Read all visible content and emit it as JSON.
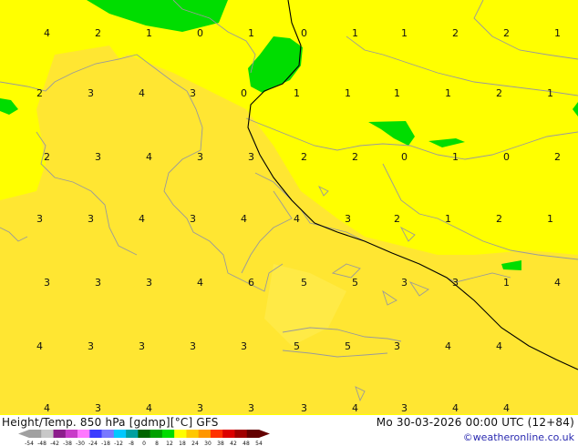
{
  "map": {
    "grid_values": [
      [
        "4",
        "2",
        "1",
        "0",
        "1",
        "0",
        "1",
        "1",
        "2",
        "2",
        "1"
      ],
      [
        "2",
        "3",
        "4",
        "3",
        "0",
        "1",
        "1",
        "1",
        "1",
        "2",
        "1"
      ],
      [
        "2",
        "3",
        "4",
        "3",
        "3",
        "2",
        "2",
        "0",
        "1",
        "0",
        "2"
      ],
      [
        "3",
        "3",
        "4",
        "3",
        "4",
        "4",
        "3",
        "2",
        "1",
        "2",
        "1"
      ],
      [
        "3",
        "3",
        "3",
        "4",
        "6",
        "5",
        "5",
        "3",
        "3",
        "1",
        "4"
      ],
      [
        "4",
        "3",
        "3",
        "3",
        "3",
        "5",
        "5",
        "3",
        "4",
        "4"
      ],
      [
        "4",
        "3",
        "4",
        "3",
        "3",
        "3",
        "4",
        "3",
        "4",
        "4"
      ]
    ],
    "colors": {
      "field_yellow": "#ffff00",
      "field_gold": "#ffe632",
      "green": "#00dd00",
      "coastline": "#9a9a9a",
      "contour": "#000000"
    }
  },
  "footer": {
    "title": "Height/Temp. 850 hPa [gdmp][°C] GFS",
    "date": "Mo 30-03-2026 00:00 UTC (12+84)",
    "credit": "©weatheronline.co.uk"
  },
  "legend": {
    "ticks": [
      "-54",
      "-48",
      "-42",
      "-38",
      "-30",
      "-24",
      "-18",
      "-12",
      "-8",
      "0",
      "8",
      "12",
      "18",
      "24",
      "30",
      "38",
      "42",
      "48",
      "54"
    ],
    "colors": [
      "#a0a0a0",
      "#c8c8c8",
      "#8c1e8c",
      "#c83cc8",
      "#ff78ff",
      "#3c3cff",
      "#7878ff",
      "#00c8ff",
      "#00a0a0",
      "#006400",
      "#00a000",
      "#00dc00",
      "#ffff00",
      "#ffc800",
      "#ff9600",
      "#ff3200",
      "#dc0000",
      "#a00000",
      "#640000"
    ]
  }
}
